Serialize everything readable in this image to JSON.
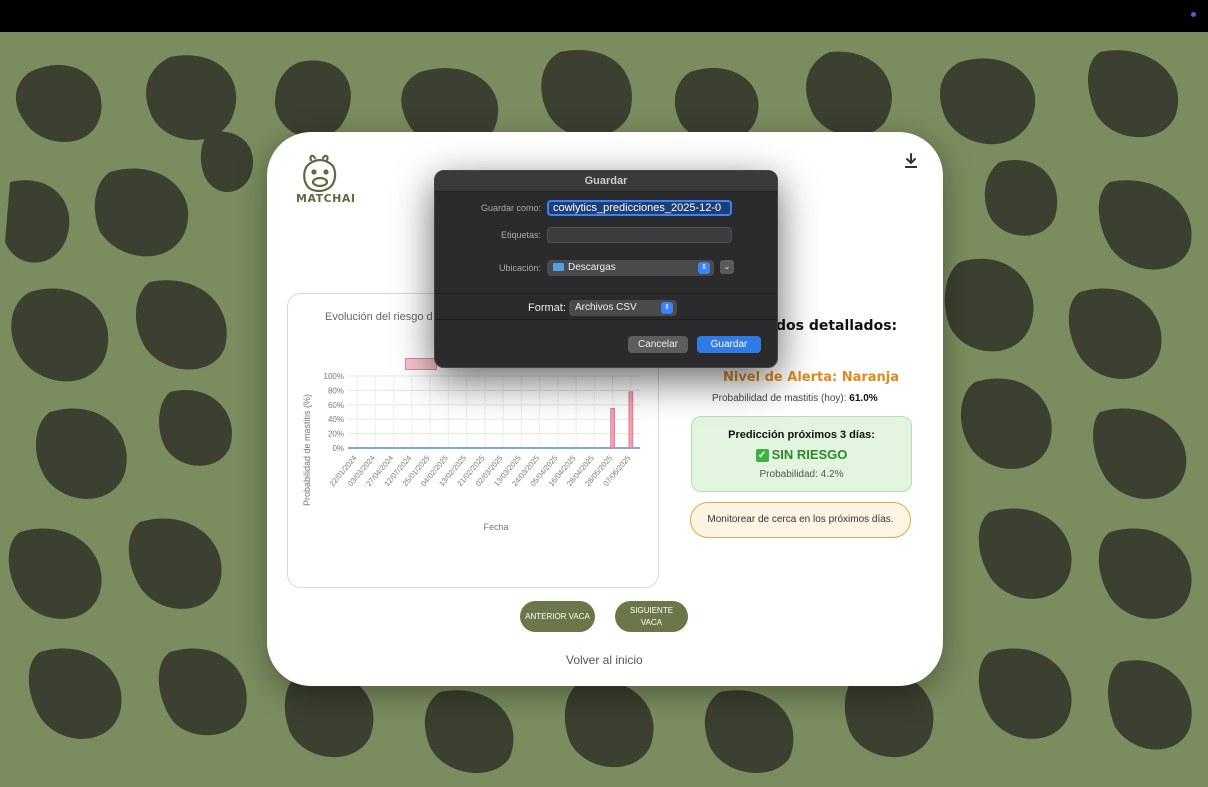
{
  "app": {
    "logo_text": "MATCHAI"
  },
  "chart": {
    "title": "Evolución del riesgo d",
    "y_axis_label": "Probabilidad de mastitis (%)",
    "x_axis_label": "Fecha",
    "y_ticks": [
      "100%",
      "80%",
      "60%",
      "40%",
      "20%",
      "0%"
    ],
    "x_ticks": [
      "22/01/2024",
      "03/03/2024",
      "27/04/2024",
      "12/07/2024",
      "25/01/2025",
      "04/02/2025",
      "13/02/2025",
      "21/02/2025",
      "02/03/2025",
      "13/03/2025",
      "24/03/2025",
      "05/04/2025",
      "16/04/2025",
      "28/04/2025",
      "28/05/2025",
      "07/06/2025"
    ]
  },
  "chart_data": {
    "type": "bar",
    "xlabel": "Fecha",
    "ylabel": "Probabilidad de mastitis (%)",
    "ylim": [
      0,
      100
    ],
    "categories": [
      "22/01/2024",
      "03/03/2024",
      "27/04/2024",
      "12/07/2024",
      "25/01/2025",
      "04/02/2025",
      "13/02/2025",
      "21/02/2025",
      "02/03/2025",
      "13/03/2025",
      "24/03/2025",
      "05/04/2025",
      "16/04/2025",
      "28/04/2025",
      "28/05/2025",
      "07/06/2025"
    ],
    "series": [
      {
        "values": [
          0,
          0,
          0,
          0,
          0,
          0,
          0,
          0,
          0,
          0,
          0,
          0,
          0,
          0,
          55,
          78
        ]
      }
    ],
    "grid": true
  },
  "details": {
    "heading": "dos detallados:",
    "alert_title": "Nivel de Alerta: Naranja",
    "prob_today_label": "Probabilidad de mastitis (hoy):",
    "prob_today_value": "61.0%"
  },
  "prediction": {
    "title": "Predicción próximos 3 días:",
    "status": "SIN RIESGO",
    "probability": "Probabilidad: 4.2%"
  },
  "monitor_message": "Monitorear de cerca en los próximos días.",
  "buttons": {
    "prev": "ANTERIOR VACA",
    "next": "SIGUIENTE VACA",
    "back": "Volver al inicio"
  },
  "dialog": {
    "title": "Guardar",
    "save_as_label": "Guardar como:",
    "save_as_value": "cowlytics_predicciones_2025-12-0",
    "tags_label": "Etiquetas:",
    "location_label": "Ubicación:",
    "location_value": "Descargas",
    "format_label": "Format:",
    "format_value": "Archivos CSV",
    "cancel": "Cancelar",
    "save": "Guardar"
  },
  "colors": {
    "background": "#7b8d5f",
    "spots": "#3b4030",
    "button": "#6b7748",
    "alert": "#e08a1e",
    "accent": "#2f7ae5"
  }
}
